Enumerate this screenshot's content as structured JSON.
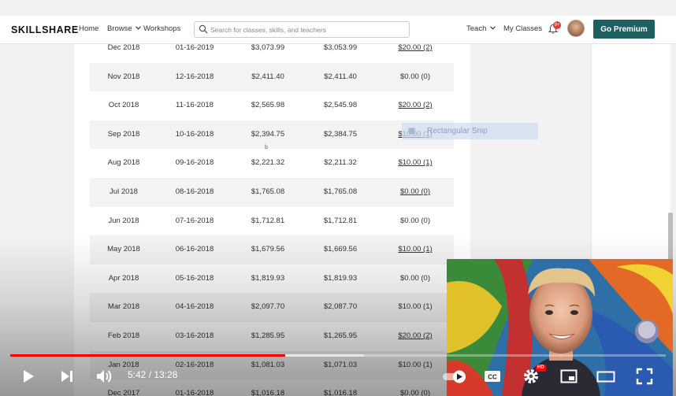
{
  "topbar": {
    "logo": "SKILLSHARE",
    "nav": {
      "home": "Home",
      "browse": "Browse",
      "workshops": "Workshops",
      "teach": "Teach",
      "my_classes": "My Classes"
    },
    "search_placeholder": "Search for classes, skills, and teachers",
    "notification_count": "9+",
    "premium_label": "Go Premium"
  },
  "table": {
    "rows": [
      [
        "Dec 2018",
        "01-16-2019",
        "$3,073.99",
        "$3,053.99",
        "$20.00 (2)"
      ],
      [
        "Nov 2018",
        "12-16-2018",
        "$2,411.40",
        "$2,411.40",
        "$0.00 (0)"
      ],
      [
        "Oct 2018",
        "11-16-2018",
        "$2,565.98",
        "$2,545.98",
        "$20.00 (2)"
      ],
      [
        "Sep 2018",
        "10-16-2018",
        "$2,394.75",
        "$2,384.75",
        "$10.00 (1)"
      ],
      [
        "Aug 2018",
        "09-16-2018",
        "$2,221.32",
        "$2,211.32",
        "$10.00 (1)"
      ],
      [
        "Jul 2018",
        "08-16-2018",
        "$1,765.08",
        "$1,765.08",
        "$0.00 (0)"
      ],
      [
        "Jun 2018",
        "07-16-2018",
        "$1,712.81",
        "$1,712.81",
        "$0.00 (0)"
      ],
      [
        "May 2018",
        "06-16-2018",
        "$1,679.56",
        "$1,669.56",
        "$10.00 (1)"
      ],
      [
        "Apr 2018",
        "05-16-2018",
        "$1,819.93",
        "$1,819.93",
        "$0.00 (0)"
      ],
      [
        "Mar 2018",
        "04-16-2018",
        "$2,097.70",
        "$2,087.70",
        "$10.00 (1)"
      ],
      [
        "Feb 2018",
        "03-16-2018",
        "$1,285.95",
        "$1,265.95",
        "$20.00 (2)"
      ],
      [
        "Jan 2018",
        "02-16-2018",
        "$1,081.03",
        "$1,071.03",
        "$10.00 (1)"
      ],
      [
        "Dec 2017",
        "01-16-2018",
        "$1,016.18",
        "$1,016.18",
        "$0.00 (0)"
      ]
    ],
    "linked_rows": [
      0,
      2,
      3,
      4,
      5,
      7,
      10
    ]
  },
  "snip_tooltip": "Rectangular Snip",
  "cursor_mark": "b",
  "player": {
    "time_current": "5:42",
    "time_total": "13:28",
    "time_display": "5:42 / 13:28",
    "progress_fraction": 0.42,
    "buffered_fraction": 0.54,
    "hd_badge": "HD"
  },
  "colors": {
    "accent": "#1e5f5f",
    "progress": "#ff0000",
    "badge": "#ee3333"
  }
}
